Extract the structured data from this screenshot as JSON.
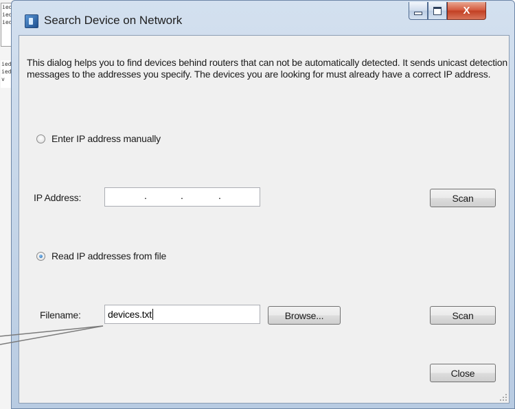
{
  "window": {
    "title": "Search Device on Network",
    "controls": {
      "minimize": "",
      "maximize": "",
      "close": "X"
    }
  },
  "description": "This dialog helps you to find devices behind routers that can not be automatically detected. It sends unicast detection messages to the addresses you specify. The devices you are looking for must already have a correct IP address.",
  "manual": {
    "radio_label": "Enter IP address manually",
    "selected": false,
    "ip_label": "IP Address:",
    "ip_value": "",
    "scan_label": "Scan"
  },
  "file": {
    "radio_label": "Read IP addresses from file",
    "selected": true,
    "filename_label": "Filename:",
    "filename_value": "devices.txt",
    "browse_label": "Browse...",
    "scan_label": "Scan"
  },
  "close_label": "Close",
  "background_text": [
    "ied",
    "ied",
    "ied",
    "ied",
    "ied",
    "v"
  ],
  "colors": {
    "titlebar": "#c3d4e8",
    "client_bg": "#f0f0f0",
    "close_button": "#c23f22",
    "radio_selected": "#1a5fa8"
  }
}
